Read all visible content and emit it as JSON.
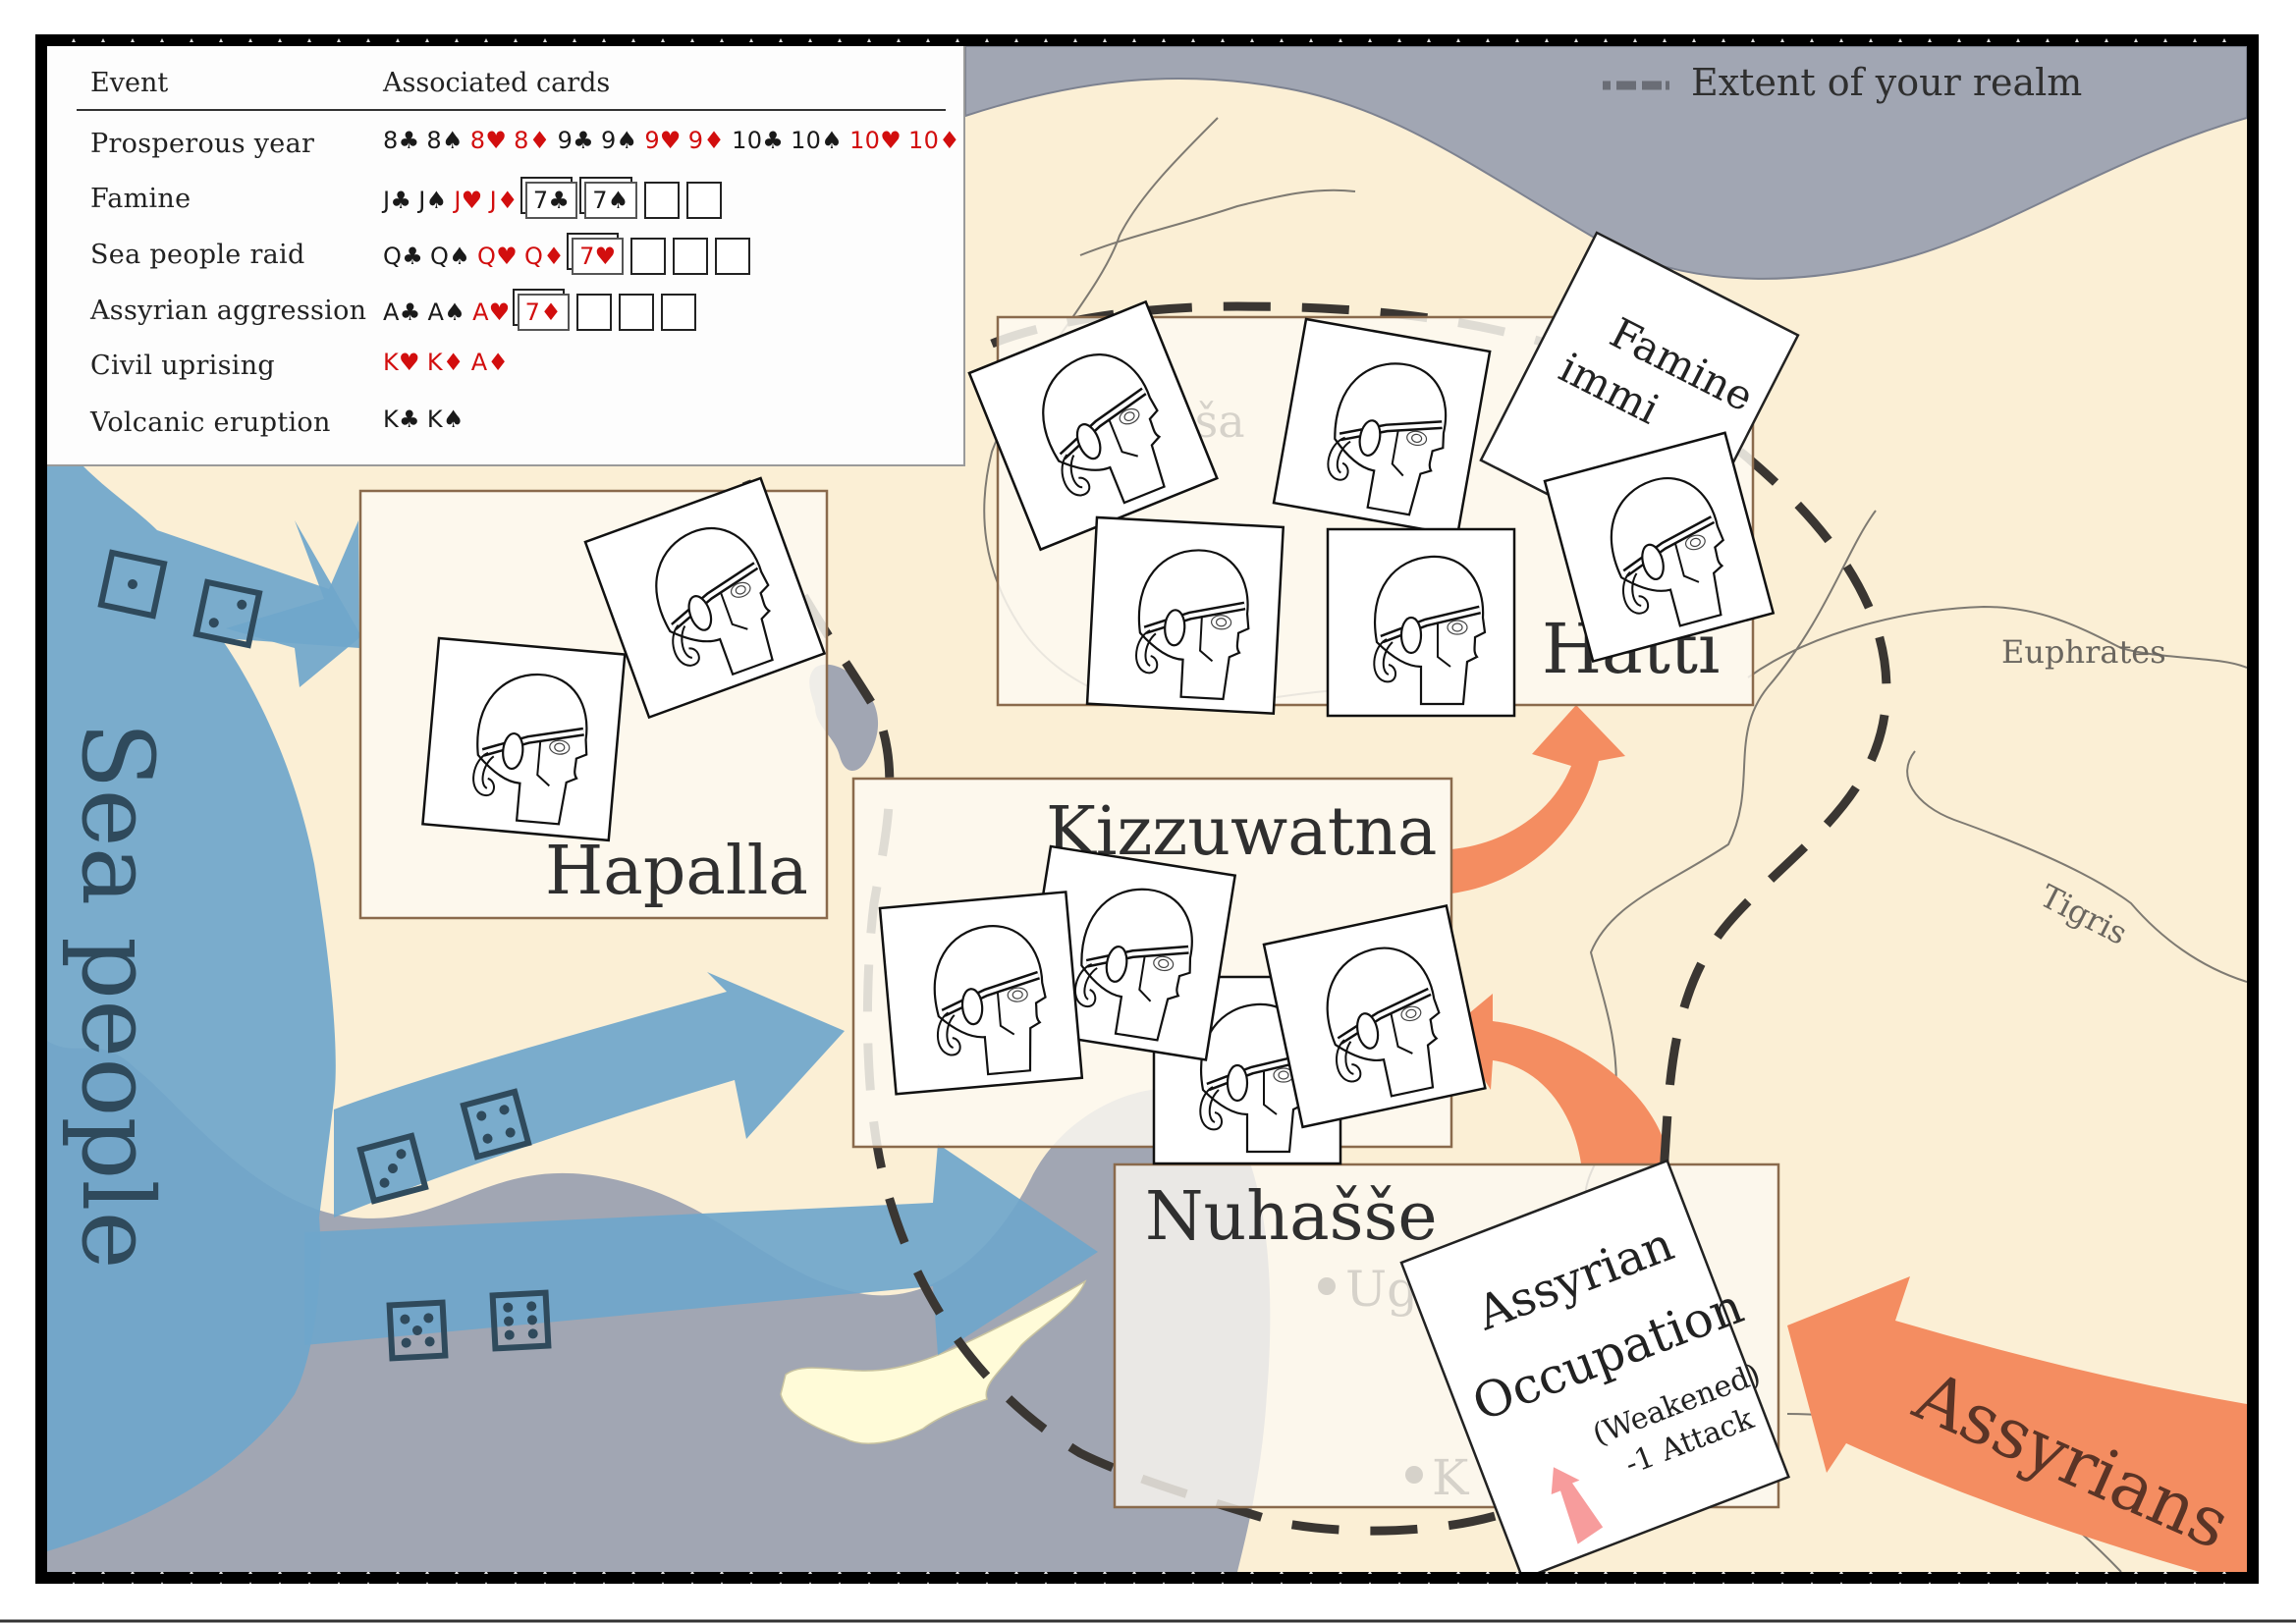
{
  "event_table": {
    "header_event": "Event",
    "header_cards": "Associated cards",
    "rows": [
      {
        "event": "Prosperous year",
        "cards": [
          {
            "rank": "8",
            "suit": "♣",
            "color": "black"
          },
          {
            "rank": "8",
            "suit": "♠",
            "color": "black"
          },
          {
            "rank": "8",
            "suit": "♥",
            "color": "red"
          },
          {
            "rank": "8",
            "suit": "♦",
            "color": "red"
          },
          {
            "rank": "9",
            "suit": "♣",
            "color": "black"
          },
          {
            "rank": "9",
            "suit": "♠",
            "color": "black"
          },
          {
            "rank": "9",
            "suit": "♥",
            "color": "red"
          },
          {
            "rank": "9",
            "suit": "♦",
            "color": "red"
          },
          {
            "rank": "10",
            "suit": "♣",
            "color": "black"
          },
          {
            "rank": "10",
            "suit": "♠",
            "color": "black"
          },
          {
            "rank": "10",
            "suit": "♥",
            "color": "red"
          },
          {
            "rank": "10",
            "suit": "♦",
            "color": "red"
          }
        ],
        "drawn_cards": [],
        "empty_slots": 0
      },
      {
        "event": "Famine",
        "cards": [
          {
            "rank": "J",
            "suit": "♣",
            "color": "black"
          },
          {
            "rank": "J",
            "suit": "♠",
            "color": "black"
          },
          {
            "rank": "J",
            "suit": "♥",
            "color": "red"
          },
          {
            "rank": "J",
            "suit": "♦",
            "color": "red"
          }
        ],
        "drawn_cards": [
          {
            "rank": "7",
            "suit": "♣",
            "color": "black"
          },
          {
            "rank": "7",
            "suit": "♠",
            "color": "black"
          }
        ],
        "empty_slots": 2
      },
      {
        "event": "Sea people raid",
        "cards": [
          {
            "rank": "Q",
            "suit": "♣",
            "color": "black"
          },
          {
            "rank": "Q",
            "suit": "♠",
            "color": "black"
          },
          {
            "rank": "Q",
            "suit": "♥",
            "color": "red"
          },
          {
            "rank": "Q",
            "suit": "♦",
            "color": "red"
          }
        ],
        "drawn_cards": [
          {
            "rank": "7",
            "suit": "♥",
            "color": "red"
          }
        ],
        "empty_slots": 3
      },
      {
        "event": "Assyrian aggression",
        "cards": [
          {
            "rank": "A",
            "suit": "♣",
            "color": "black"
          },
          {
            "rank": "A",
            "suit": "♠",
            "color": "black"
          },
          {
            "rank": "A",
            "suit": "♥",
            "color": "red"
          }
        ],
        "drawn_cards": [
          {
            "rank": "7",
            "suit": "♦",
            "color": "red"
          }
        ],
        "empty_slots": 3
      },
      {
        "event": "Civil uprising",
        "cards": [
          {
            "rank": "K",
            "suit": "♥",
            "color": "red"
          },
          {
            "rank": "K",
            "suit": "♦",
            "color": "red"
          },
          {
            "rank": "A",
            "suit": "♦",
            "color": "red"
          }
        ],
        "drawn_cards": [],
        "empty_slots": 0
      },
      {
        "event": "Volcanic eruption",
        "cards": [
          {
            "rank": "K",
            "suit": "♣",
            "color": "black"
          },
          {
            "rank": "K",
            "suit": "♠",
            "color": "black"
          }
        ],
        "drawn_cards": [],
        "empty_slots": 0
      }
    ]
  },
  "legend": {
    "realm_extent_label": "Extent of your realm",
    "icon": "dashed-line-icon"
  },
  "regions": {
    "hapalla": {
      "name": "Hapalla",
      "army_cards": 2
    },
    "hatti": {
      "name": "Hatti",
      "army_cards": 5,
      "city": "Hattuša",
      "city_visible": "ttuša"
    },
    "kizzuwatna": {
      "name": "Kizzuwatna",
      "army_cards": 4
    },
    "nuhasse": {
      "name": "Nuhašše",
      "army_cards": 0,
      "cities": [
        "Ug",
        "K"
      ]
    }
  },
  "event_cards": {
    "famine": {
      "line1": "Famine",
      "line2_visible": "immi"
    },
    "assyrian_occupation": {
      "title_line1": "Assyrian",
      "title_line2": "Occupation",
      "status": "(Weakened)",
      "effect": "-1 Attack",
      "icon": "attack-arrow-icon"
    }
  },
  "factions": {
    "sea_people": {
      "label": "Sea people",
      "attacks": [
        {
          "target": "Hapalla",
          "dice": [
            1,
            2
          ]
        },
        {
          "target": "Kizzuwatna",
          "dice": [
            3,
            4
          ]
        },
        {
          "target": "Nuhašše",
          "dice": [
            5,
            6
          ]
        }
      ]
    },
    "assyrians": {
      "label": "Assyrians",
      "attacks": [
        "Nuhašše",
        "Kizzuwatna",
        "Hatti"
      ]
    }
  },
  "rivers": {
    "euphrates": "Euphrates",
    "tigris": "Tigris"
  },
  "colors": {
    "land": "#fbefd5",
    "sea": "#a1a6b3",
    "sea_people": "#6fa6cb",
    "assyrians": "#f48d61",
    "region_fill": "#fdf9f1",
    "region_border": "#8a6a4c",
    "card_red": "#d20e0e",
    "dice": "#2f4a5c",
    "cyprus": "#fffbd8"
  }
}
